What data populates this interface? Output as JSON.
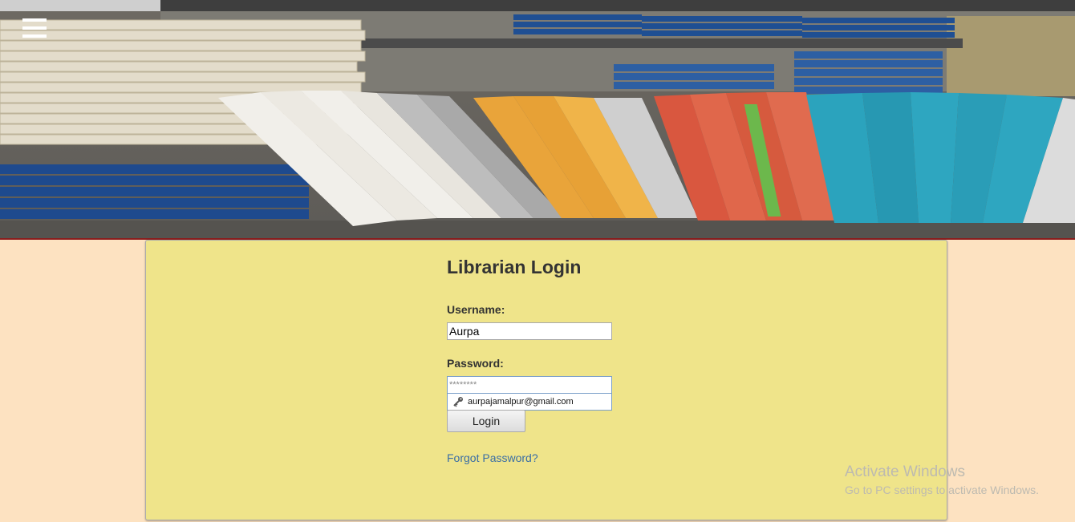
{
  "header": {
    "menu_icon": "hamburger-menu-icon"
  },
  "login": {
    "title": "Librarian Login",
    "username_label": "Username:",
    "username_value": "Aurpa",
    "password_label": "Password:",
    "password_value": "********",
    "autocomplete_icon": "key-icon",
    "autocomplete_suggestion": "aurpajamalpur@gmail.com",
    "login_button": "Login",
    "forgot_link": "Forgot Password?"
  },
  "watermark": {
    "title": "Activate Windows",
    "subtitle": "Go to PC settings to activate Windows."
  },
  "colors": {
    "page_bg": "#fde2c1",
    "panel_bg": "#efe48a",
    "link": "#3a6ea5"
  }
}
